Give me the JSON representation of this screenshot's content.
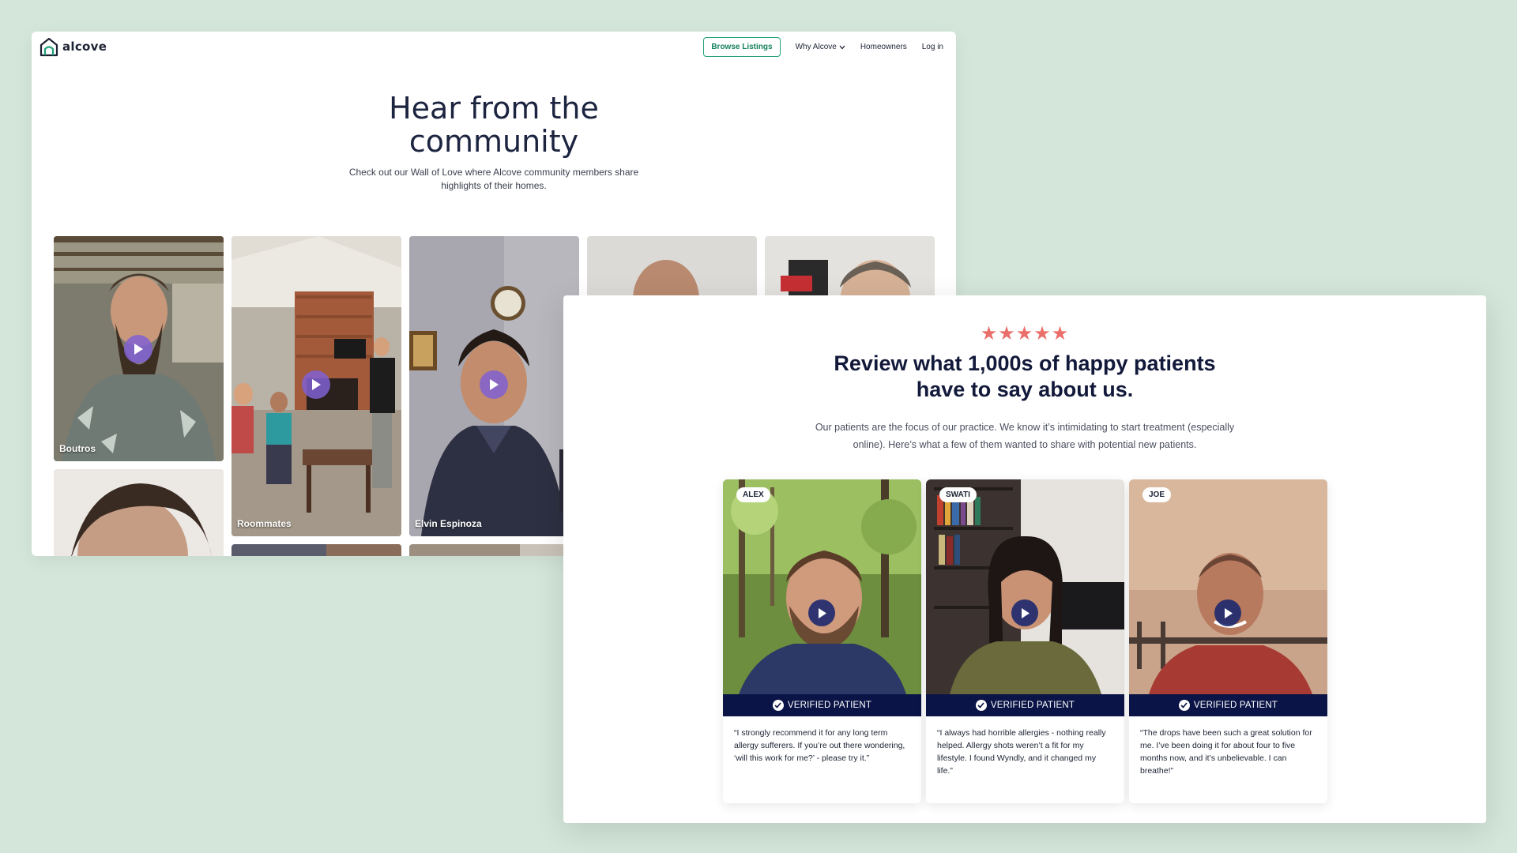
{
  "colors": {
    "background": "#d3e6d9",
    "alcove_accent": "#1fa07a",
    "wyndly_navy": "#0b1446",
    "stars": "#ea6e6a"
  },
  "alcove": {
    "logo_text": "alcove",
    "nav": {
      "browse_label": "Browse Listings",
      "why_label": "Why Alcove",
      "homeowners_label": "Homeowners",
      "login_label": "Log in"
    },
    "hero": {
      "title_line1": "Hear from the",
      "title_line2": "community",
      "subtitle": "Check out our Wall of Love where Alcove community members share highlights of their homes."
    },
    "videos": [
      {
        "name": "Boutros"
      },
      {
        "name": "Roommates"
      },
      {
        "name": "Elvin Espinoza"
      }
    ]
  },
  "wyndly": {
    "stars": "★★★★★",
    "title_line1": "Review what 1,000s of happy patients",
    "title_line2": "have to say about us.",
    "subtitle": "Our patients are the focus of our practice. We know it’s intimidating to start treatment (especially online). Here’s what a few of them wanted to share with potential new patients.",
    "badge_label": "VERIFIED PATIENT",
    "testimonials": [
      {
        "name": "ALEX",
        "quote": "“I strongly recommend it for any long term allergy sufferers. If you’re out there wondering, ‘will this work for me?’ - please try it.”"
      },
      {
        "name": "SWATI",
        "quote": "“I always had horrible allergies - nothing really helped. Allergy shots weren’t a fit for my lifestyle. I found Wyndly, and it changed my life.”"
      },
      {
        "name": "JOE",
        "quote": "“The drops have been such a great solution for me. I’ve been doing it for about four to five months now, and it’s unbelievable. I can breathe!”"
      }
    ]
  }
}
